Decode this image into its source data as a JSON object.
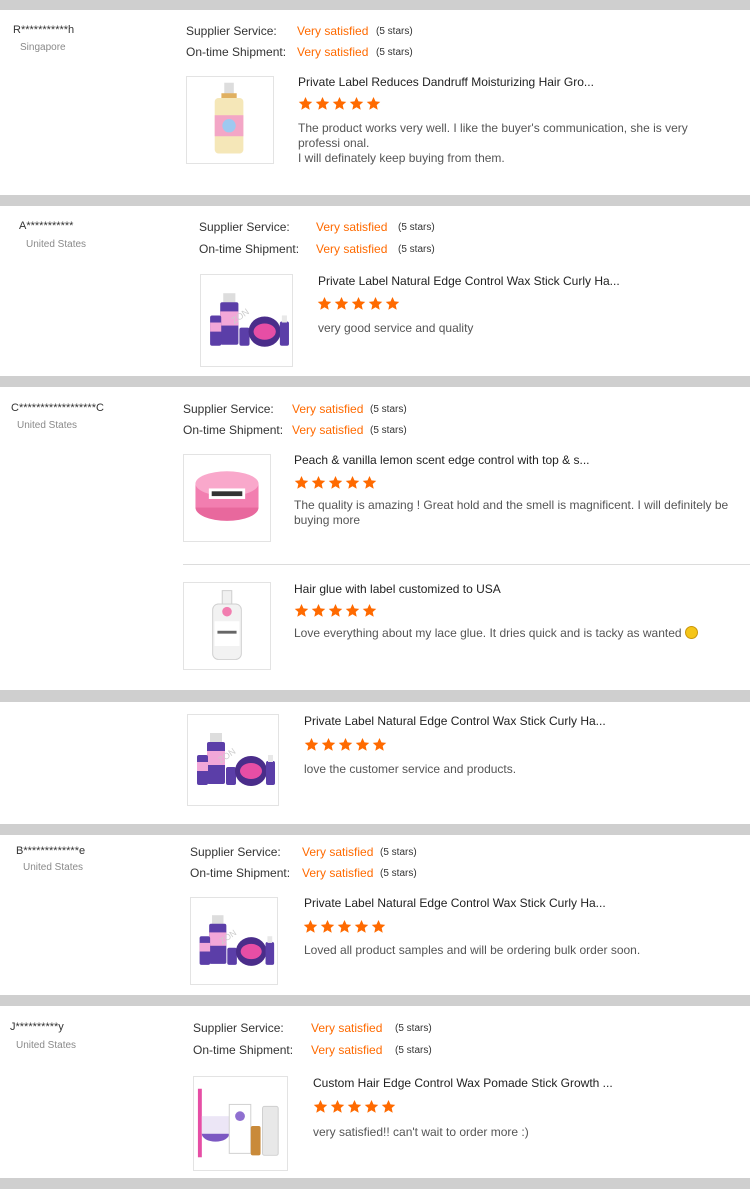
{
  "labels": {
    "supplier_service": "Supplier Service:",
    "ontime_shipment": "On-time Shipment:"
  },
  "colors": {
    "accent": "#ff6a00",
    "star": "#ff6a00",
    "separator": "#cfcfcf"
  },
  "reviews": [
    {
      "buyer": "R***********h",
      "country": "Singapore",
      "supplier_service": "Very satisfied",
      "supplier_stars": "(5 stars)",
      "ontime_shipment": "Very satisfied",
      "ontime_stars": "(5 stars)",
      "products": [
        {
          "title": "Private Label Reduces Dandruff Moisturizing Hair Gro...",
          "rating": 5,
          "text": "The product works very well. I like the buyer's communication, she is very professi onal.",
          "text2": "I will definately keep buying from them.",
          "image_icon": "hair-oil-bottle-icon"
        }
      ]
    },
    {
      "buyer": "A***********",
      "country": "United States",
      "supplier_service": "Very satisfied",
      "supplier_stars": "(5 stars)",
      "ontime_shipment": "Very satisfied",
      "ontime_stars": "(5 stars)",
      "products": [
        {
          "title": "Private Label Natural Edge Control Wax Stick Curly Ha...",
          "rating": 5,
          "text": "very good service and quality",
          "image_icon": "edge-control-kit-icon"
        }
      ]
    },
    {
      "buyer": "C******************C",
      "country": "United States",
      "supplier_service": "Very satisfied",
      "supplier_stars": "(5 stars)",
      "ontime_shipment": "Very satisfied",
      "ontime_stars": "(5 stars)",
      "products": [
        {
          "title": "Peach & vanilla lemon scent edge control with top & s...",
          "rating": 5,
          "text": "The quality is amazing ! Great hold and the smell is magnificent. I will definitely be buying more",
          "image_icon": "pink-edge-control-jar-icon"
        },
        {
          "title": "Hair glue with label customized to USA",
          "rating": 5,
          "text": "Love everything about my lace glue. It dries quick and is tacky as wanted",
          "emoji_icon": "smiling-face-emoji",
          "image_icon": "lace-glue-bottle-icon"
        }
      ]
    },
    {
      "buyer": "",
      "country": "",
      "products": [
        {
          "title": "Private Label Natural Edge Control Wax Stick Curly Ha...",
          "rating": 5,
          "text": "love the customer service and products.",
          "image_icon": "edge-control-kit-icon"
        }
      ]
    },
    {
      "buyer": "B*************e",
      "country": "United States",
      "supplier_service": "Very satisfied",
      "supplier_stars": "(5 stars)",
      "ontime_shipment": "Very satisfied",
      "ontime_stars": "(5 stars)",
      "products": [
        {
          "title": "Private Label Natural Edge Control Wax Stick Curly Ha...",
          "rating": 5,
          "text": "Loved all product samples and will be ordering bulk order soon.",
          "image_icon": "edge-control-kit-icon"
        }
      ]
    },
    {
      "buyer": "J**********y",
      "country": "United States",
      "supplier_service": "Very satisfied",
      "supplier_stars": "(5 stars)",
      "ontime_shipment": "Very satisfied",
      "ontime_stars": "(5 stars)",
      "products": [
        {
          "title": "Custom Hair Edge Control Wax Pomade Stick Growth ...",
          "rating": 5,
          "text": "very satisfied!! can't wait to order more :)",
          "image_icon": "pomade-kit-icon"
        }
      ]
    }
  ]
}
